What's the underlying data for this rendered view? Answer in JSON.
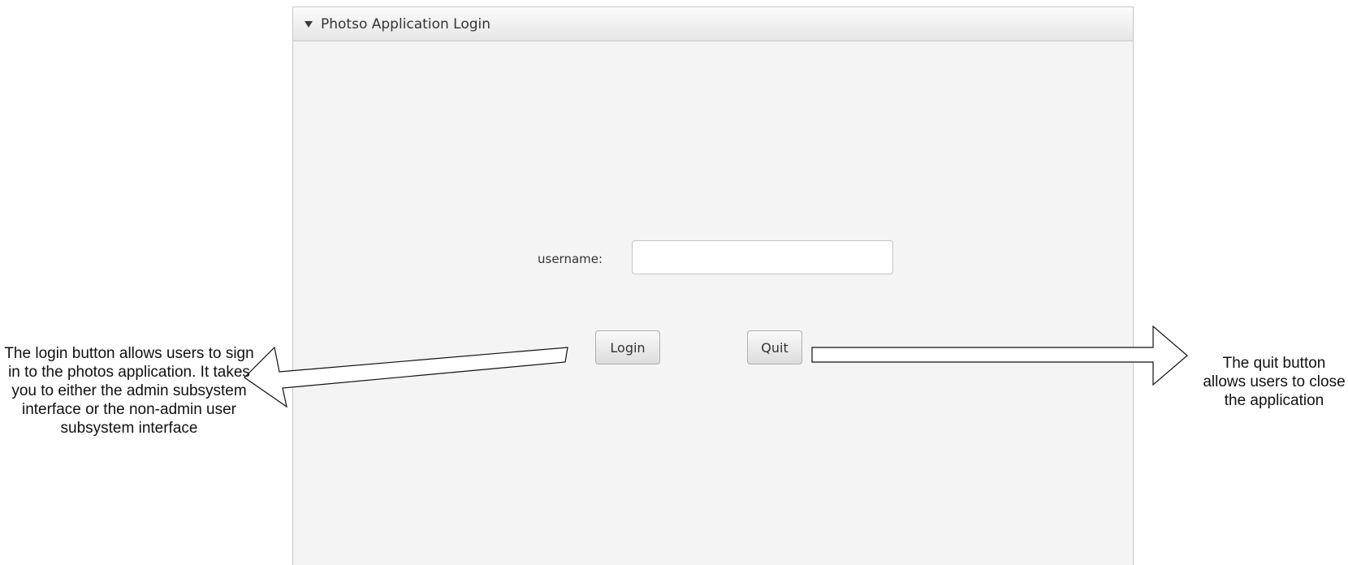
{
  "window": {
    "title": "Photso Application Login"
  },
  "form": {
    "username_label": "username:",
    "username_value": "",
    "login_label": "Login",
    "quit_label": "Quit"
  },
  "annotations": {
    "login_note": "The login button allows users to sign in to the photos application. It takes you to either the admin subsystem interface or the non-admin user subsystem interface",
    "quit_note": "The quit button allows users to close the application"
  }
}
